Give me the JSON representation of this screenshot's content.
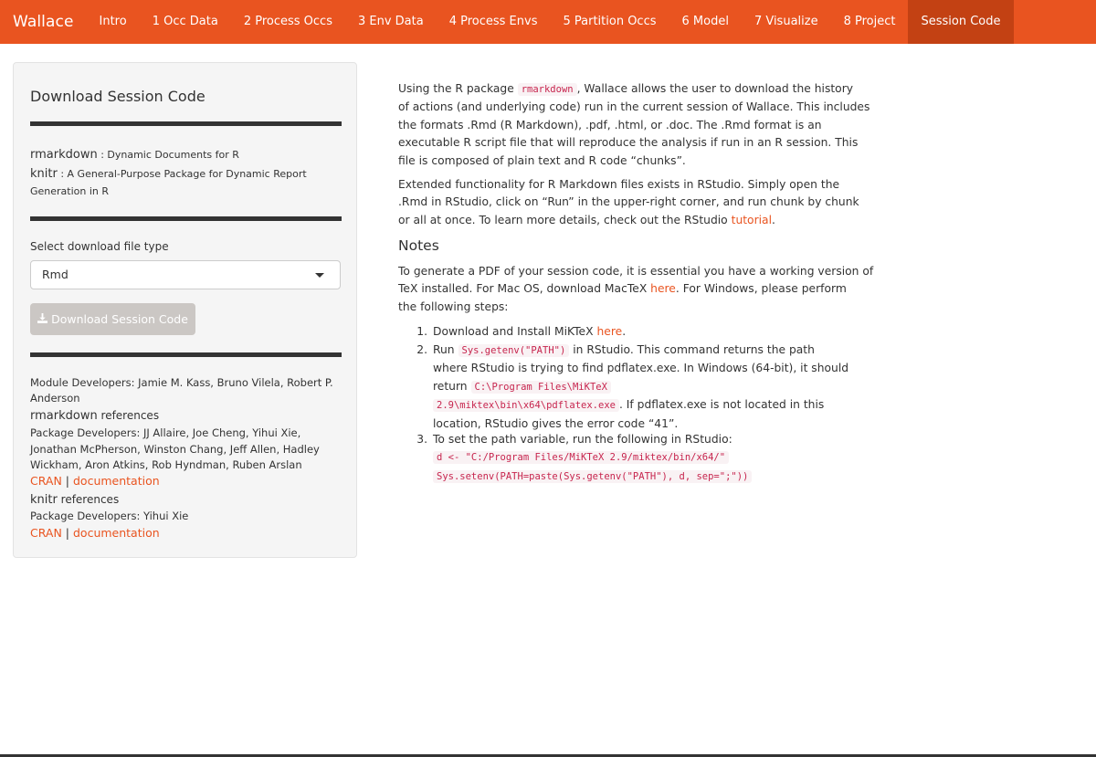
{
  "navbar": {
    "brand": "Wallace",
    "tabs": [
      {
        "label": "Intro"
      },
      {
        "label": "1 Occ Data"
      },
      {
        "label": "2 Process Occs"
      },
      {
        "label": "3 Env Data"
      },
      {
        "label": "4 Process Envs"
      },
      {
        "label": "5 Partition Occs"
      },
      {
        "label": "6 Model"
      },
      {
        "label": "7 Visualize"
      },
      {
        "label": "8 Project"
      },
      {
        "label": "Session Code",
        "active": true
      }
    ]
  },
  "sidebar": {
    "title": "Download Session Code",
    "packages": [
      {
        "name": "rmarkdown",
        "desc": " : Dynamic Documents for R"
      },
      {
        "name": "knitr",
        "desc": " : A General-Purpose Package for Dynamic Report",
        "desc2": "Generation in R"
      }
    ],
    "select_label": "Select download file type",
    "select_value": "Rmd",
    "download_button": "Download Session Code",
    "module_developers_line1": "Module Developers: Jamie M. Kass, Bruno Vilela, Robert P.",
    "module_developers_line2": "Anderson",
    "refs": [
      {
        "pkg": "rmarkdown",
        "suffix": " references",
        "dev_lines": [
          "Package Developers: JJ Allaire, Joe Cheng, Yihui Xie,",
          "Jonathan McPherson, Winston Chang, Jeff Allen, Hadley",
          "Wickham, Aron Atkins, Rob Hyndman, Ruben Arslan"
        ],
        "link1": "CRAN",
        "sep": " | ",
        "link2": "documentation"
      },
      {
        "pkg": "knitr",
        "suffix": " references",
        "dev_lines": [
          "Package Developers: Yihui Xie"
        ],
        "link1": "CRAN",
        "sep": " | ",
        "link2": "documentation"
      }
    ]
  },
  "main": {
    "para1": {
      "l1a": "Using the R package ",
      "l1code": "rmarkdown",
      "l1b": ", Wallace allows the user to download the history",
      "l2": "of actions (and underlying code) run in the current session of Wallace. This includes",
      "l3": "the formats .Rmd (R Markdown), .pdf, .html, or .doc. The .Rmd format is an",
      "l4": "executable R script file that will reproduce the analysis if run in an R session. This",
      "l5": "file is composed of plain text and R code “chunks”."
    },
    "para2": {
      "l1": "Extended functionality for R Markdown files exists in RStudio. Simply open the",
      "l2": ".Rmd in RStudio, click on “Run” in the upper-right corner, and run chunk by chunk",
      "l3a": "or all at once. To learn more details, check out the RStudio ",
      "l3link": "tutorial",
      "l3b": "."
    },
    "notes_heading": "Notes",
    "para3": {
      "l1": "To generate a PDF of your session code, it is essential you have a working version of",
      "l2a": "TeX installed. For Mac OS, download MacTeX ",
      "l2link": "here",
      "l2b": ". For Windows, please perform",
      "l3": "the following steps:"
    },
    "steps": [
      {
        "num": "1.",
        "a": "Download and Install MiKTeX ",
        "link": "here",
        "b": "."
      },
      {
        "num": "2.",
        "l1a": "Run ",
        "l1code": "Sys.getenv(\"PATH\")",
        "l1b": " in RStudio. This command returns the path",
        "l2": "where RStudio is trying to find pdflatex.exe. In Windows (64-bit), it should",
        "l3a": "return ",
        "l3code": "C:\\Program Files\\MiKTeX",
        "l4code": "2.9\\miktex\\bin\\x64\\pdflatex.exe",
        "l4b": ". If pdflatex.exe is not located in this",
        "l5": "location, RStudio gives the error code “41”."
      },
      {
        "num": "3.",
        "l1": "To set the path variable, run the following in RStudio:",
        "code1": "d <- \"C:/Program Files/MiKTeX 2.9/miktex/bin/x64/\"",
        "code2": "Sys.setenv(PATH=paste(Sys.getenv(\"PATH\"), d, sep=\";\"))"
      }
    ]
  }
}
